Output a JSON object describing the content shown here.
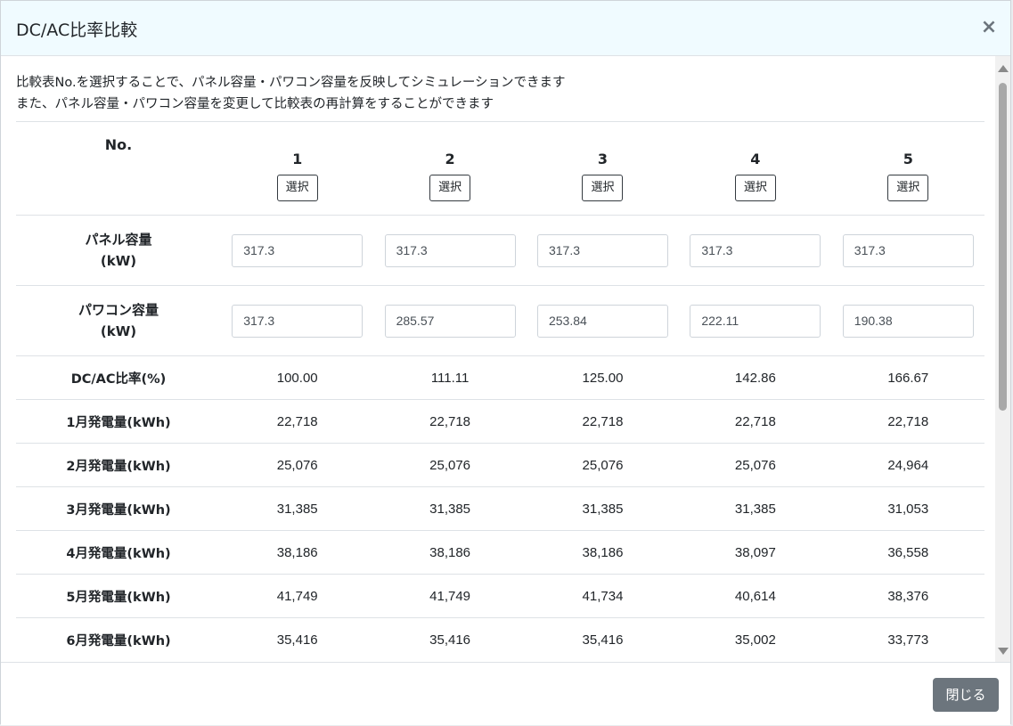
{
  "modal": {
    "title": "DC/AC比率比較",
    "close_symbol": "×",
    "close_button_label": "閉じる"
  },
  "description": {
    "line1": "比較表No.を選択することで、パネル容量・パワコン容量を反映してシミュレーションできます",
    "line2": "また、パネル容量・パワコン容量を変更して比較表の再計算をすることができます"
  },
  "table": {
    "no_label": "No.",
    "columns": [
      "1",
      "2",
      "3",
      "4",
      "5"
    ],
    "select_label": "選択",
    "panel": {
      "label_line1": "パネル容量",
      "label_line2": "(kW)",
      "values": [
        "317.3",
        "317.3",
        "317.3",
        "317.3",
        "317.3"
      ]
    },
    "pcs": {
      "label_line1": "パワコン容量",
      "label_line2": "(kW)",
      "values": [
        "317.3",
        "285.57",
        "253.84",
        "222.11",
        "190.38"
      ]
    },
    "rows": [
      {
        "label": "DC/AC比率(%)",
        "values": [
          "100.00",
          "111.11",
          "125.00",
          "142.86",
          "166.67"
        ]
      },
      {
        "label": "1月発電量(kWh)",
        "values": [
          "22,718",
          "22,718",
          "22,718",
          "22,718",
          "22,718"
        ]
      },
      {
        "label": "2月発電量(kWh)",
        "values": [
          "25,076",
          "25,076",
          "25,076",
          "25,076",
          "24,964"
        ]
      },
      {
        "label": "3月発電量(kWh)",
        "values": [
          "31,385",
          "31,385",
          "31,385",
          "31,385",
          "31,053"
        ]
      },
      {
        "label": "4月発電量(kWh)",
        "values": [
          "38,186",
          "38,186",
          "38,186",
          "38,097",
          "36,558"
        ]
      },
      {
        "label": "5月発電量(kWh)",
        "values": [
          "41,749",
          "41,749",
          "41,734",
          "40,614",
          "38,376"
        ]
      },
      {
        "label": "6月発電量(kWh)",
        "values": [
          "35,416",
          "35,416",
          "35,416",
          "35,002",
          "33,773"
        ]
      }
    ]
  }
}
